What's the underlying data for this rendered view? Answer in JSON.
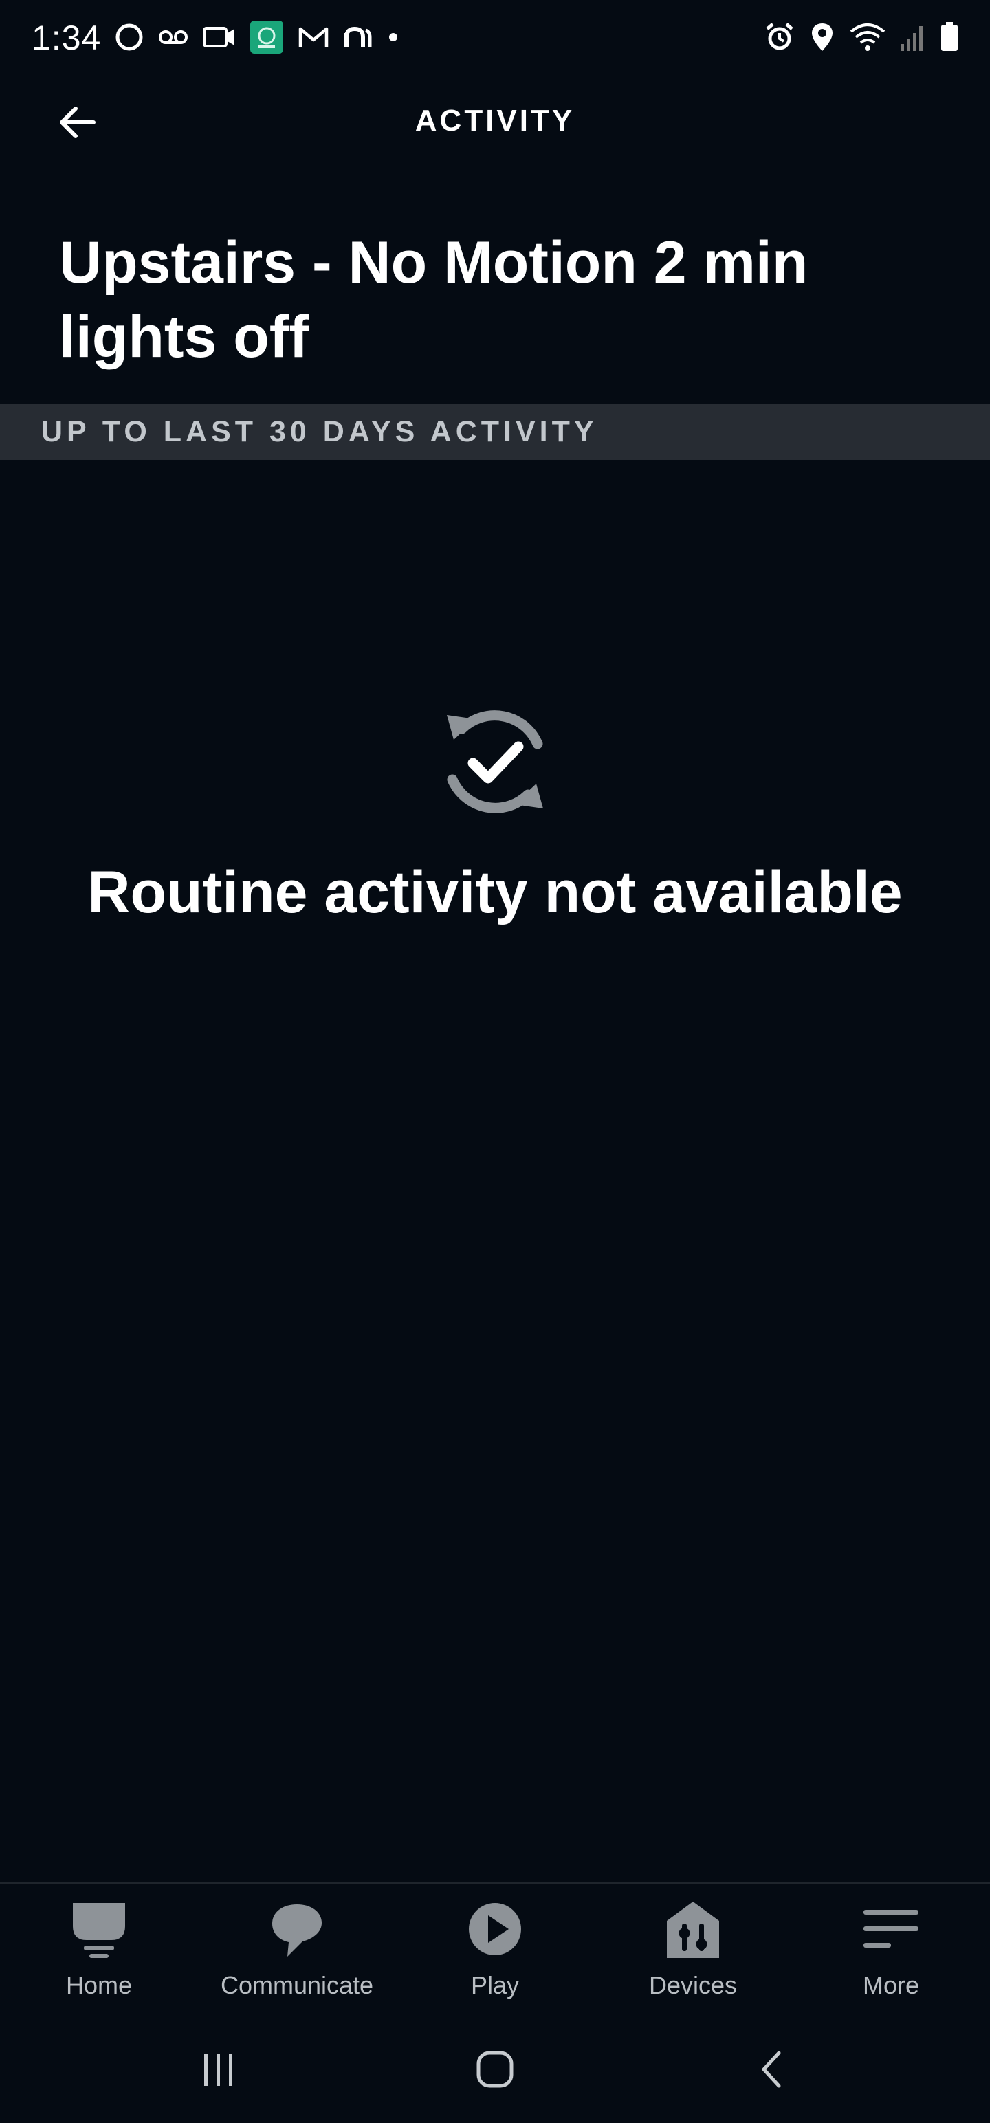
{
  "status_bar": {
    "time": "1:34"
  },
  "header": {
    "title": "ACTIVITY"
  },
  "routine": {
    "title": "Upstairs - No Motion 2 min lights off"
  },
  "section": {
    "label": "UP TO LAST 30 DAYS ACTIVITY"
  },
  "empty_state": {
    "message": "Routine activity not available"
  },
  "bottom_nav": {
    "items": [
      {
        "label": "Home",
        "icon": "home-icon"
      },
      {
        "label": "Communicate",
        "icon": "speech-bubble-icon"
      },
      {
        "label": "Play",
        "icon": "play-icon"
      },
      {
        "label": "Devices",
        "icon": "devices-icon"
      },
      {
        "label": "More",
        "icon": "menu-icon"
      }
    ]
  },
  "colors": {
    "background": "#050b13",
    "section_band": "#272c33",
    "icon_gray": "#8e9398",
    "nav_label": "#b9bec3"
  }
}
